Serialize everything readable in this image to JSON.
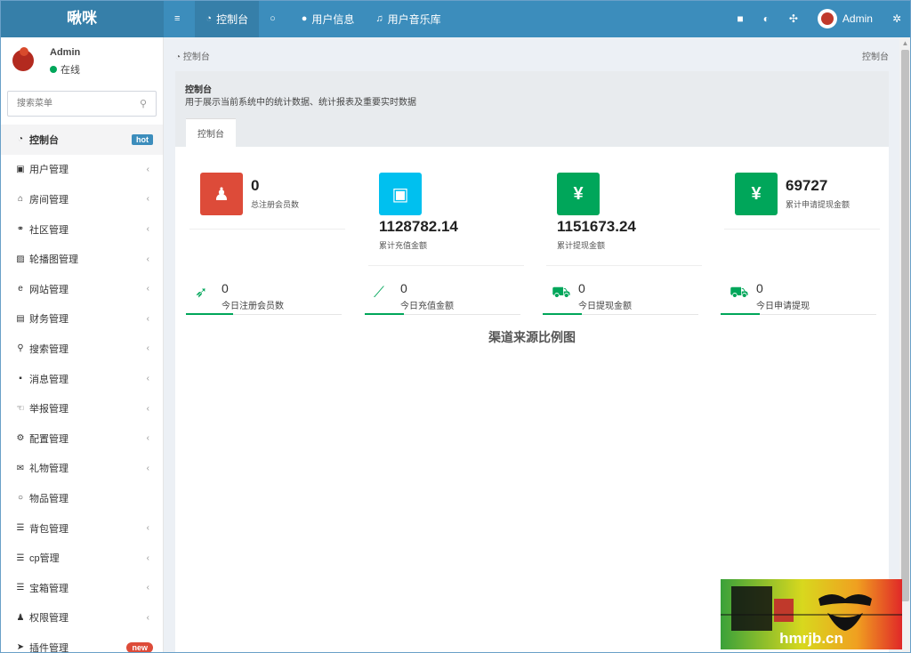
{
  "app": {
    "logo": "啾咪"
  },
  "topnav": [
    {
      "label": "",
      "icon": "menu-icon",
      "glyph": "≡"
    },
    {
      "label": "控制台",
      "icon": "dashboard-icon",
      "glyph": "◔",
      "active": true
    },
    {
      "label": "",
      "icon": "circle-icon",
      "glyph": "○"
    },
    {
      "label": "用户信息",
      "icon": "user-icon",
      "glyph": "●"
    },
    {
      "label": "用户音乐库",
      "icon": "music-icon",
      "glyph": "♫"
    }
  ],
  "topright": {
    "trash_glyph": "■",
    "translate_glyph": "◐",
    "fullscreen_glyph": "✣",
    "username": "Admin",
    "settings_glyph": "✲"
  },
  "sidebar": {
    "user_name": "Admin",
    "status": "在线",
    "search_placeholder": "搜索菜单",
    "search_glyph": "⚲",
    "items": [
      {
        "label": "控制台",
        "glyph": "◔",
        "icon": "dashboard-icon",
        "badge": "hot",
        "active": true
      },
      {
        "label": "用户管理",
        "glyph": "▣",
        "icon": "user-card-icon",
        "chevron": "‹"
      },
      {
        "label": "房间管理",
        "glyph": "⌂",
        "icon": "bank-icon",
        "chevron": "‹"
      },
      {
        "label": "社区管理",
        "glyph": "⚭",
        "icon": "bicycle-icon",
        "chevron": "‹"
      },
      {
        "label": "轮播图管理",
        "glyph": "▨",
        "icon": "image-icon",
        "chevron": "‹"
      },
      {
        "label": "网站管理",
        "glyph": "e",
        "icon": "internet-explorer-icon",
        "chevron": "‹"
      },
      {
        "label": "财务管理",
        "glyph": "▤",
        "icon": "money-icon",
        "chevron": "‹"
      },
      {
        "label": "搜索管理",
        "glyph": "⚲",
        "icon": "search-icon",
        "chevron": "‹"
      },
      {
        "label": "消息管理",
        "glyph": "▪",
        "icon": "message-icon",
        "chevron": "‹"
      },
      {
        "label": "举报管理",
        "glyph": "☜",
        "icon": "hand-icon",
        "chevron": "‹"
      },
      {
        "label": "配置管理",
        "glyph": "⚙",
        "icon": "sitemap-icon",
        "chevron": "‹"
      },
      {
        "label": "礼物管理",
        "glyph": "✉",
        "icon": "gift-icon",
        "chevron": "‹"
      },
      {
        "label": "物品管理",
        "glyph": "○",
        "icon": "circle-icon"
      },
      {
        "label": "背包管理",
        "glyph": "☰",
        "icon": "list-icon",
        "chevron": "‹"
      },
      {
        "label": "cp管理",
        "glyph": "☰",
        "icon": "list-icon",
        "chevron": "‹"
      },
      {
        "label": "宝箱管理",
        "glyph": "☰",
        "icon": "list-icon",
        "chevron": "‹"
      },
      {
        "label": "权限管理",
        "glyph": "♟",
        "icon": "users-icon",
        "chevron": "‹"
      },
      {
        "label": "插件管理",
        "glyph": "➤",
        "icon": "rocket-icon",
        "badge": "new"
      }
    ]
  },
  "content": {
    "breadcrumb": "控制台",
    "breadcrumb_glyph": "◔",
    "breadcrumb_right": "控制台",
    "panel_title": "控制台",
    "panel_desc": "用于展示当前系统中的统计数据、统计报表及重要实时数据",
    "tab_label": "控制台",
    "stats": [
      {
        "value": "0",
        "label": "总注册会员数",
        "glyph": "♟",
        "icon": "users-icon",
        "color": "#dd4b39"
      },
      {
        "value": "1128782.14",
        "label": "累计充值金额",
        "glyph": "▣",
        "icon": "shopping-bag-icon",
        "color": "#00c0ef"
      },
      {
        "value": "1151673.24",
        "label": "累计提现金额",
        "glyph": "¥",
        "icon": "yen-icon",
        "color": "#00a65a"
      },
      {
        "value": "69727",
        "label": "累计申请提现金额",
        "glyph": "¥",
        "icon": "yen-icon",
        "color": "#00a65a"
      }
    ],
    "mini_stats": [
      {
        "value": "0",
        "label": "今日注册会员数",
        "glyph": "➶",
        "icon": "rocket-icon",
        "progress": 0.3
      },
      {
        "value": "0",
        "label": "今日充值金额",
        "glyph": "⟋",
        "icon": "line-chart-icon",
        "progress": 0.25
      },
      {
        "value": "0",
        "label": "今日提现金额",
        "glyph": "⛟",
        "icon": "cart-icon",
        "progress": 0.25
      },
      {
        "value": "0",
        "label": "今日申请提现",
        "glyph": "⛟",
        "icon": "cart-icon",
        "progress": 0.25
      }
    ],
    "chart_title": "渠道来源比例图"
  },
  "watermark": {
    "text": "hmrjb.cn"
  }
}
